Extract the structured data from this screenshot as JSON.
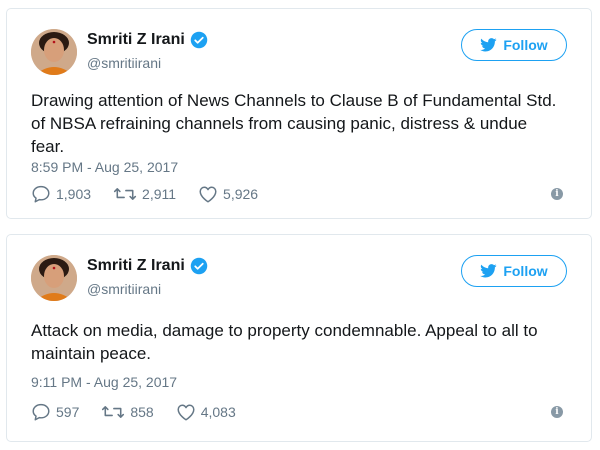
{
  "tweets": [
    {
      "author": {
        "name": "Smriti Z Irani",
        "handle": "@smritiirani",
        "verified": true
      },
      "follow_label": "Follow",
      "text": "Drawing attention of News Channels to Clause B of Fundamental Std. of NBSA refraining channels from causing panic, distress & undue fear.",
      "timestamp": "8:59 PM - Aug 25, 2017",
      "replies": "1,903",
      "retweets": "2,911",
      "likes": "5,926"
    },
    {
      "author": {
        "name": "Smriti Z Irani",
        "handle": "@smritiirani",
        "verified": true
      },
      "follow_label": "Follow",
      "text": "Attack on media, damage to property condemnable. Appeal to all to maintain peace.",
      "timestamp": "9:11 PM - Aug 25, 2017",
      "replies": "597",
      "retweets": "858",
      "likes": "4,083"
    }
  ],
  "colors": {
    "accent": "#1da1f2",
    "muted": "#657786",
    "border": "#e1e8ed",
    "text": "#14171a"
  },
  "icons": [
    "verified-icon",
    "twitter-bird-icon",
    "reply-icon",
    "retweet-icon",
    "like-icon",
    "info-icon"
  ]
}
